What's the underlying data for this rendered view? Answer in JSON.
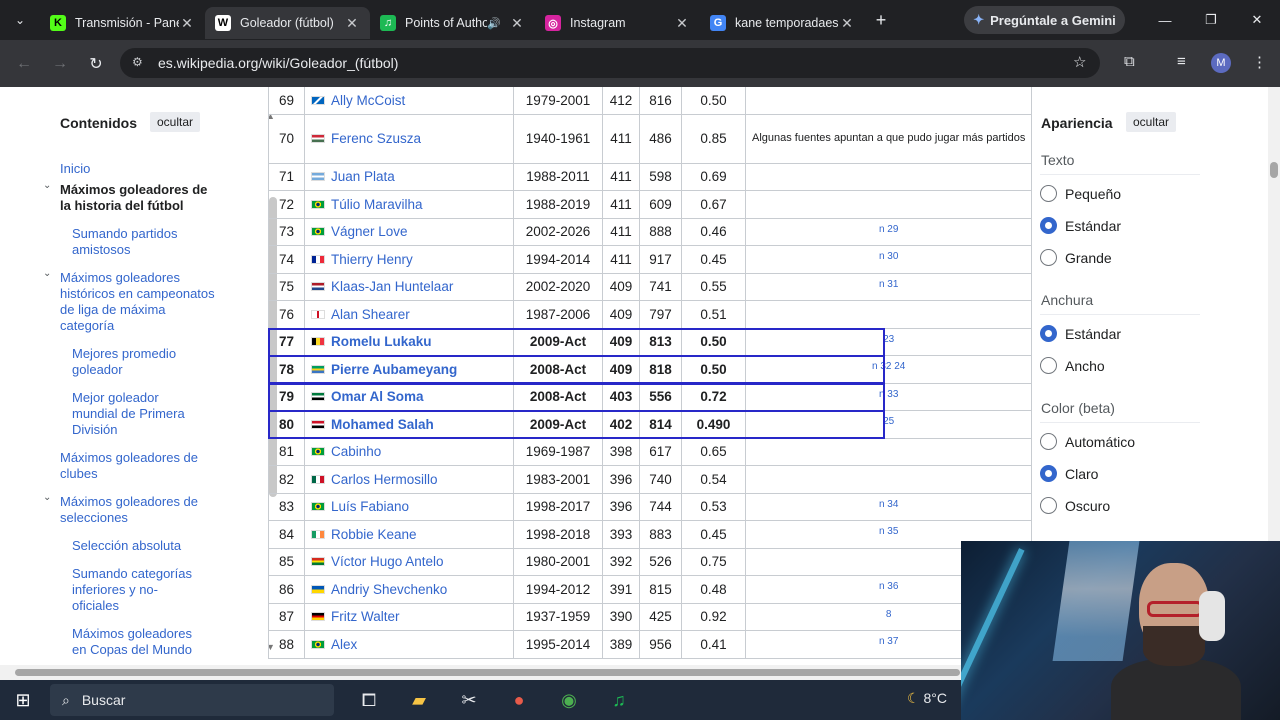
{
  "browser": {
    "tabs": [
      {
        "title": "Transmisión - Panel",
        "favicon": "kick-icon",
        "color": "#53fc18",
        "glyph": "K",
        "active": false,
        "audio": false
      },
      {
        "title": "Goleador (fútbol)",
        "favicon": "wikipedia-icon",
        "color": "#ffffff",
        "glyph": "W",
        "active": true,
        "audio": false
      },
      {
        "title": "Points of Authority",
        "favicon": "spotify-icon",
        "color": "#1db954",
        "glyph": "♫",
        "active": false,
        "audio": true
      },
      {
        "title": "Instagram",
        "favicon": "instagram-icon",
        "color": "#d6249f",
        "glyph": "◎",
        "active": false,
        "audio": false
      },
      {
        "title": "kane temporadaes",
        "favicon": "google-icon",
        "color": "#4285f4",
        "glyph": "G",
        "active": false,
        "audio": false
      }
    ],
    "gemini_label": "Pregúntale a Gemini",
    "url": "es.wikipedia.org/wiki/Goleador_(fútbol)",
    "profile_initial": "M"
  },
  "toc": {
    "title": "Contenidos",
    "hide": "ocultar",
    "items": [
      {
        "label": "Inicio",
        "level": 1,
        "bold": false,
        "caret": false
      },
      {
        "label": "Máximos goleadores de la historia del fútbol",
        "level": 1,
        "bold": true,
        "caret": true
      },
      {
        "label": "Sumando partidos amistosos",
        "level": 2,
        "bold": false,
        "caret": false
      },
      {
        "label": "Máximos goleadores históricos en campeonatos de liga de máxima categoría",
        "level": 1,
        "bold": false,
        "caret": true
      },
      {
        "label": "Mejores promedio goleador",
        "level": 2,
        "bold": false,
        "caret": false
      },
      {
        "label": "Mejor goleador mundial de Primera División",
        "level": 2,
        "bold": false,
        "caret": false
      },
      {
        "label": "Máximos goleadores de clubes",
        "level": 1,
        "bold": false,
        "caret": false
      },
      {
        "label": "Máximos goleadores de selecciones",
        "level": 1,
        "bold": false,
        "caret": true
      },
      {
        "label": "Selección absoluta",
        "level": 2,
        "bold": false,
        "caret": false
      },
      {
        "label": "Sumando categorías inferiores y no-oficiales",
        "level": 2,
        "bold": false,
        "caret": false
      },
      {
        "label": "Máximos goleadores en Copas del Mundo",
        "level": 2,
        "bold": false,
        "caret": false
      }
    ]
  },
  "table": {
    "rows": [
      {
        "rank": "69",
        "name": "Ally McCoist",
        "flag": "scotland",
        "years": "1979-2001",
        "goals": "412",
        "matches": "816",
        "avg": "0.50",
        "note": "",
        "highlight": false
      },
      {
        "rank": "70",
        "name": "Ferenc Szusza",
        "flag": "hungary",
        "years": "1940-1961",
        "goals": "411",
        "matches": "486",
        "avg": "0.85",
        "note": "Algunas fuentes apuntan a que pudo jugar más partidos",
        "highlight": false
      },
      {
        "rank": "71",
        "name": "Juan Plata",
        "flag": "argentina",
        "years": "1988-2011",
        "goals": "411",
        "matches": "598",
        "avg": "0.69",
        "note": "",
        "highlight": false
      },
      {
        "rank": "72",
        "name": "Túlio Maravilha",
        "flag": "brazil",
        "years": "1988-2019",
        "goals": "411",
        "matches": "609",
        "avg": "0.67",
        "note": "",
        "highlight": false
      },
      {
        "rank": "73",
        "name": "Vágner Love",
        "flag": "brazil",
        "years": "2002-2026",
        "goals": "411",
        "matches": "888",
        "avg": "0.46",
        "note": "n 29",
        "highlight": false
      },
      {
        "rank": "74",
        "name": "Thierry Henry",
        "flag": "france",
        "years": "1994-2014",
        "goals": "411",
        "matches": "917",
        "avg": "0.45",
        "note": "n 30",
        "highlight": false
      },
      {
        "rank": "75",
        "name": "Klaas-Jan Huntelaar",
        "flag": "netherlands",
        "years": "2002-2020",
        "goals": "409",
        "matches": "741",
        "avg": "0.55",
        "note": "n 31",
        "highlight": false
      },
      {
        "rank": "76",
        "name": "Alan Shearer",
        "flag": "england",
        "years": "1987-2006",
        "goals": "409",
        "matches": "797",
        "avg": "0.51",
        "note": "",
        "highlight": false
      },
      {
        "rank": "77",
        "name": "Romelu Lukaku",
        "flag": "belgium",
        "years": "2009-Act",
        "goals": "409",
        "matches": "813",
        "avg": "0.50",
        "note": "23",
        "highlight": true
      },
      {
        "rank": "78",
        "name": "Pierre Aubameyang",
        "flag": "gabon",
        "years": "2008-Act",
        "goals": "409",
        "matches": "818",
        "avg": "0.50",
        "note": "n 32 24",
        "highlight": true
      },
      {
        "rank": "79",
        "name": "Omar Al Soma",
        "flag": "syria",
        "years": "2008-Act",
        "goals": "403",
        "matches": "556",
        "avg": "0.72",
        "note": "n 33",
        "highlight": true
      },
      {
        "rank": "80",
        "name": "Mohamed Salah",
        "flag": "egypt",
        "years": "2009-Act",
        "goals": "402",
        "matches": "814",
        "avg": "0.490",
        "note": "25",
        "highlight": true
      },
      {
        "rank": "81",
        "name": "Cabinho",
        "flag": "brazil",
        "years": "1969-1987",
        "goals": "398",
        "matches": "617",
        "avg": "0.65",
        "note": "",
        "highlight": false
      },
      {
        "rank": "82",
        "name": "Carlos Hermosillo",
        "flag": "mexico",
        "years": "1983-2001",
        "goals": "396",
        "matches": "740",
        "avg": "0.54",
        "note": "",
        "highlight": false
      },
      {
        "rank": "83",
        "name": "Luís Fabiano",
        "flag": "brazil",
        "years": "1998-2017",
        "goals": "396",
        "matches": "744",
        "avg": "0.53",
        "note": "n 34",
        "highlight": false
      },
      {
        "rank": "84",
        "name": "Robbie Keane",
        "flag": "ireland",
        "years": "1998-2018",
        "goals": "393",
        "matches": "883",
        "avg": "0.45",
        "note": "n 35",
        "highlight": false
      },
      {
        "rank": "85",
        "name": "Víctor Hugo Antelo",
        "flag": "bolivia",
        "years": "1980-2001",
        "goals": "392",
        "matches": "526",
        "avg": "0.75",
        "note": "",
        "highlight": false
      },
      {
        "rank": "86",
        "name": "Andriy Shevchenko",
        "flag": "ukraine",
        "years": "1994-2012",
        "goals": "391",
        "matches": "815",
        "avg": "0.48",
        "note": "n 36",
        "highlight": false
      },
      {
        "rank": "87",
        "name": "Fritz Walter",
        "flag": "germany",
        "years": "1937-1959",
        "goals": "390",
        "matches": "425",
        "avg": "0.92",
        "note": "8",
        "highlight": false
      },
      {
        "rank": "88",
        "name": "Alex",
        "flag": "brazil",
        "years": "1995-2014",
        "goals": "389",
        "matches": "956",
        "avg": "0.41",
        "note": "n 37",
        "highlight": false
      }
    ]
  },
  "appearance": {
    "title": "Apariencia",
    "hide": "ocultar",
    "groups": [
      {
        "heading": "Texto",
        "options": [
          {
            "label": "Pequeño",
            "on": false
          },
          {
            "label": "Estándar",
            "on": true
          },
          {
            "label": "Grande",
            "on": false
          }
        ]
      },
      {
        "heading": "Anchura",
        "options": [
          {
            "label": "Estándar",
            "on": true
          },
          {
            "label": "Ancho",
            "on": false
          }
        ]
      },
      {
        "heading": "Color (beta)",
        "options": [
          {
            "label": "Automático",
            "on": false
          },
          {
            "label": "Claro",
            "on": true
          },
          {
            "label": "Oscuro",
            "on": false
          }
        ]
      }
    ]
  },
  "taskbar": {
    "search_placeholder": "Buscar",
    "weather": "8°C"
  },
  "colors": {
    "link": "#3366cc",
    "highlight_border": "#2828c8",
    "chrome_dark": "#202124"
  }
}
